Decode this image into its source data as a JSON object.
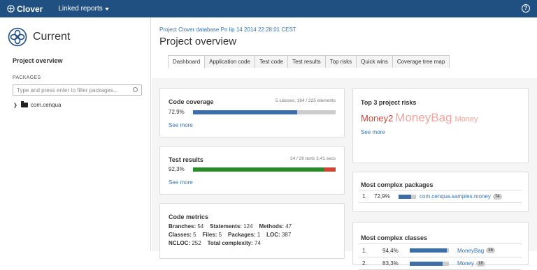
{
  "topbar": {
    "brand": "Clover",
    "linked_reports": "Linked reports"
  },
  "sidebar": {
    "title": "Current",
    "project_overview": "Project overview",
    "packages_label": "PACKAGES",
    "filter_placeholder": "Type and press enter to filter packages...",
    "tree": [
      {
        "label": "com.cenqua"
      }
    ]
  },
  "header": {
    "breadcrumb": "Project Clover database Pn lip 14 2014 22:28:01 CEST",
    "title": "Project overview"
  },
  "tabs": [
    {
      "label": "Dashboard",
      "active": true
    },
    {
      "label": "Application code"
    },
    {
      "label": "Test code"
    },
    {
      "label": "Test results"
    },
    {
      "label": "Top risks"
    },
    {
      "label": "Quick wins"
    },
    {
      "label": "Coverage tree map"
    }
  ],
  "code_coverage": {
    "title": "Code coverage",
    "summary": "5 classes, 164 / 225 elements",
    "percent": "72,9%",
    "value": 72.9,
    "see_more": "See more"
  },
  "test_results": {
    "title": "Test results",
    "summary": "24 / 26 tests 3,41 secs",
    "percent": "92,3%",
    "value": 92.3,
    "see_more": "See more"
  },
  "code_metrics": {
    "title": "Code metrics",
    "l1": {
      "branches_k": "Branches:",
      "branches_v": "54",
      "statements_k": "Statements:",
      "statements_v": "124",
      "methods_k": "Methods:",
      "methods_v": "47"
    },
    "l2": {
      "classes_k": "Classes:",
      "classes_v": "5",
      "files_k": "Files:",
      "files_v": "5",
      "packages_k": "Packages:",
      "packages_v": "1",
      "loc_k": "LOC:",
      "loc_v": "387"
    },
    "l3": {
      "ncloc_k": "NCLOC:",
      "ncloc_v": "252",
      "complexity_k": "Total complexity:",
      "complexity_v": "74"
    }
  },
  "top_risks": {
    "title": "Top 3 project risks",
    "items": [
      "Money2",
      "MoneyBag",
      "Money"
    ],
    "see_more": "See more"
  },
  "complex_packages": {
    "title": "Most complex packages",
    "rows": [
      {
        "index": "1.",
        "percent": "72,9%",
        "value": 72.9,
        "name": "com.cenqua.samples.money",
        "badge": "74"
      }
    ]
  },
  "complex_classes": {
    "title": "Most complex classes",
    "rows": [
      {
        "index": "1.",
        "percent": "94,4%",
        "value": 94.4,
        "name": "MoneyBag",
        "badge": "36"
      },
      {
        "index": "2.",
        "percent": "83,3%",
        "value": 83.3,
        "name": "Money",
        "badge": "18"
      }
    ]
  },
  "colors": {
    "header": "#205081",
    "link": "#3572b0",
    "coverage": "#3d6ea8",
    "pass": "#2a8a2a",
    "fail": "#d04437"
  }
}
